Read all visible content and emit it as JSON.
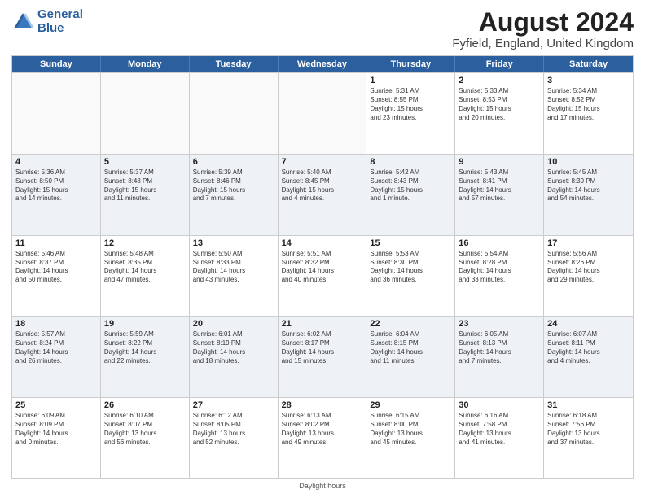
{
  "header": {
    "logo_line1": "General",
    "logo_line2": "Blue",
    "month_year": "August 2024",
    "location": "Fyfield, England, United Kingdom"
  },
  "weekdays": [
    "Sunday",
    "Monday",
    "Tuesday",
    "Wednesday",
    "Thursday",
    "Friday",
    "Saturday"
  ],
  "footer": "Daylight hours",
  "rows": [
    [
      {
        "day": "",
        "info": ""
      },
      {
        "day": "",
        "info": ""
      },
      {
        "day": "",
        "info": ""
      },
      {
        "day": "",
        "info": ""
      },
      {
        "day": "1",
        "info": "Sunrise: 5:31 AM\nSunset: 8:55 PM\nDaylight: 15 hours\nand 23 minutes."
      },
      {
        "day": "2",
        "info": "Sunrise: 5:33 AM\nSunset: 8:53 PM\nDaylight: 15 hours\nand 20 minutes."
      },
      {
        "day": "3",
        "info": "Sunrise: 5:34 AM\nSunset: 8:52 PM\nDaylight: 15 hours\nand 17 minutes."
      }
    ],
    [
      {
        "day": "4",
        "info": "Sunrise: 5:36 AM\nSunset: 8:50 PM\nDaylight: 15 hours\nand 14 minutes."
      },
      {
        "day": "5",
        "info": "Sunrise: 5:37 AM\nSunset: 8:48 PM\nDaylight: 15 hours\nand 11 minutes."
      },
      {
        "day": "6",
        "info": "Sunrise: 5:39 AM\nSunset: 8:46 PM\nDaylight: 15 hours\nand 7 minutes."
      },
      {
        "day": "7",
        "info": "Sunrise: 5:40 AM\nSunset: 8:45 PM\nDaylight: 15 hours\nand 4 minutes."
      },
      {
        "day": "8",
        "info": "Sunrise: 5:42 AM\nSunset: 8:43 PM\nDaylight: 15 hours\nand 1 minute."
      },
      {
        "day": "9",
        "info": "Sunrise: 5:43 AM\nSunset: 8:41 PM\nDaylight: 14 hours\nand 57 minutes."
      },
      {
        "day": "10",
        "info": "Sunrise: 5:45 AM\nSunset: 8:39 PM\nDaylight: 14 hours\nand 54 minutes."
      }
    ],
    [
      {
        "day": "11",
        "info": "Sunrise: 5:46 AM\nSunset: 8:37 PM\nDaylight: 14 hours\nand 50 minutes."
      },
      {
        "day": "12",
        "info": "Sunrise: 5:48 AM\nSunset: 8:35 PM\nDaylight: 14 hours\nand 47 minutes."
      },
      {
        "day": "13",
        "info": "Sunrise: 5:50 AM\nSunset: 8:33 PM\nDaylight: 14 hours\nand 43 minutes."
      },
      {
        "day": "14",
        "info": "Sunrise: 5:51 AM\nSunset: 8:32 PM\nDaylight: 14 hours\nand 40 minutes."
      },
      {
        "day": "15",
        "info": "Sunrise: 5:53 AM\nSunset: 8:30 PM\nDaylight: 14 hours\nand 36 minutes."
      },
      {
        "day": "16",
        "info": "Sunrise: 5:54 AM\nSunset: 8:28 PM\nDaylight: 14 hours\nand 33 minutes."
      },
      {
        "day": "17",
        "info": "Sunrise: 5:56 AM\nSunset: 8:26 PM\nDaylight: 14 hours\nand 29 minutes."
      }
    ],
    [
      {
        "day": "18",
        "info": "Sunrise: 5:57 AM\nSunset: 8:24 PM\nDaylight: 14 hours\nand 26 minutes."
      },
      {
        "day": "19",
        "info": "Sunrise: 5:59 AM\nSunset: 8:22 PM\nDaylight: 14 hours\nand 22 minutes."
      },
      {
        "day": "20",
        "info": "Sunrise: 6:01 AM\nSunset: 8:19 PM\nDaylight: 14 hours\nand 18 minutes."
      },
      {
        "day": "21",
        "info": "Sunrise: 6:02 AM\nSunset: 8:17 PM\nDaylight: 14 hours\nand 15 minutes."
      },
      {
        "day": "22",
        "info": "Sunrise: 6:04 AM\nSunset: 8:15 PM\nDaylight: 14 hours\nand 11 minutes."
      },
      {
        "day": "23",
        "info": "Sunrise: 6:05 AM\nSunset: 8:13 PM\nDaylight: 14 hours\nand 7 minutes."
      },
      {
        "day": "24",
        "info": "Sunrise: 6:07 AM\nSunset: 8:11 PM\nDaylight: 14 hours\nand 4 minutes."
      }
    ],
    [
      {
        "day": "25",
        "info": "Sunrise: 6:09 AM\nSunset: 8:09 PM\nDaylight: 14 hours\nand 0 minutes."
      },
      {
        "day": "26",
        "info": "Sunrise: 6:10 AM\nSunset: 8:07 PM\nDaylight: 13 hours\nand 56 minutes."
      },
      {
        "day": "27",
        "info": "Sunrise: 6:12 AM\nSunset: 8:05 PM\nDaylight: 13 hours\nand 52 minutes."
      },
      {
        "day": "28",
        "info": "Sunrise: 6:13 AM\nSunset: 8:02 PM\nDaylight: 13 hours\nand 49 minutes."
      },
      {
        "day": "29",
        "info": "Sunrise: 6:15 AM\nSunset: 8:00 PM\nDaylight: 13 hours\nand 45 minutes."
      },
      {
        "day": "30",
        "info": "Sunrise: 6:16 AM\nSunset: 7:58 PM\nDaylight: 13 hours\nand 41 minutes."
      },
      {
        "day": "31",
        "info": "Sunrise: 6:18 AM\nSunset: 7:56 PM\nDaylight: 13 hours\nand 37 minutes."
      }
    ]
  ]
}
